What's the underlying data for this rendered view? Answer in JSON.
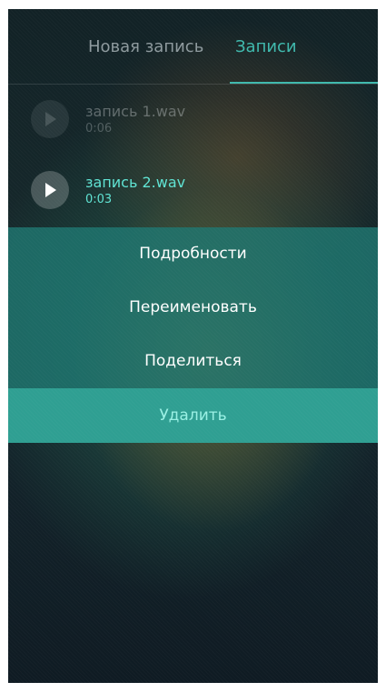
{
  "tabs": {
    "new_record": "Новая запись",
    "records": "Записи",
    "active": "records"
  },
  "recordings": [
    {
      "name": "запись 1.wav",
      "duration": "0:06",
      "icon": "play-icon"
    },
    {
      "name": "запись 2.wav",
      "duration": "0:03",
      "icon": "play-icon"
    }
  ],
  "context_menu": {
    "items": [
      {
        "label": "Подробности"
      },
      {
        "label": "Переименовать"
      },
      {
        "label": "Поделиться"
      },
      {
        "label": "Удалить",
        "highlighted": true
      }
    ]
  },
  "colors": {
    "accent": "#3fb9ad",
    "accent_text": "#5fe3d3",
    "menu_bg": "#1e7670",
    "menu_highlight": "#2f9f92"
  }
}
